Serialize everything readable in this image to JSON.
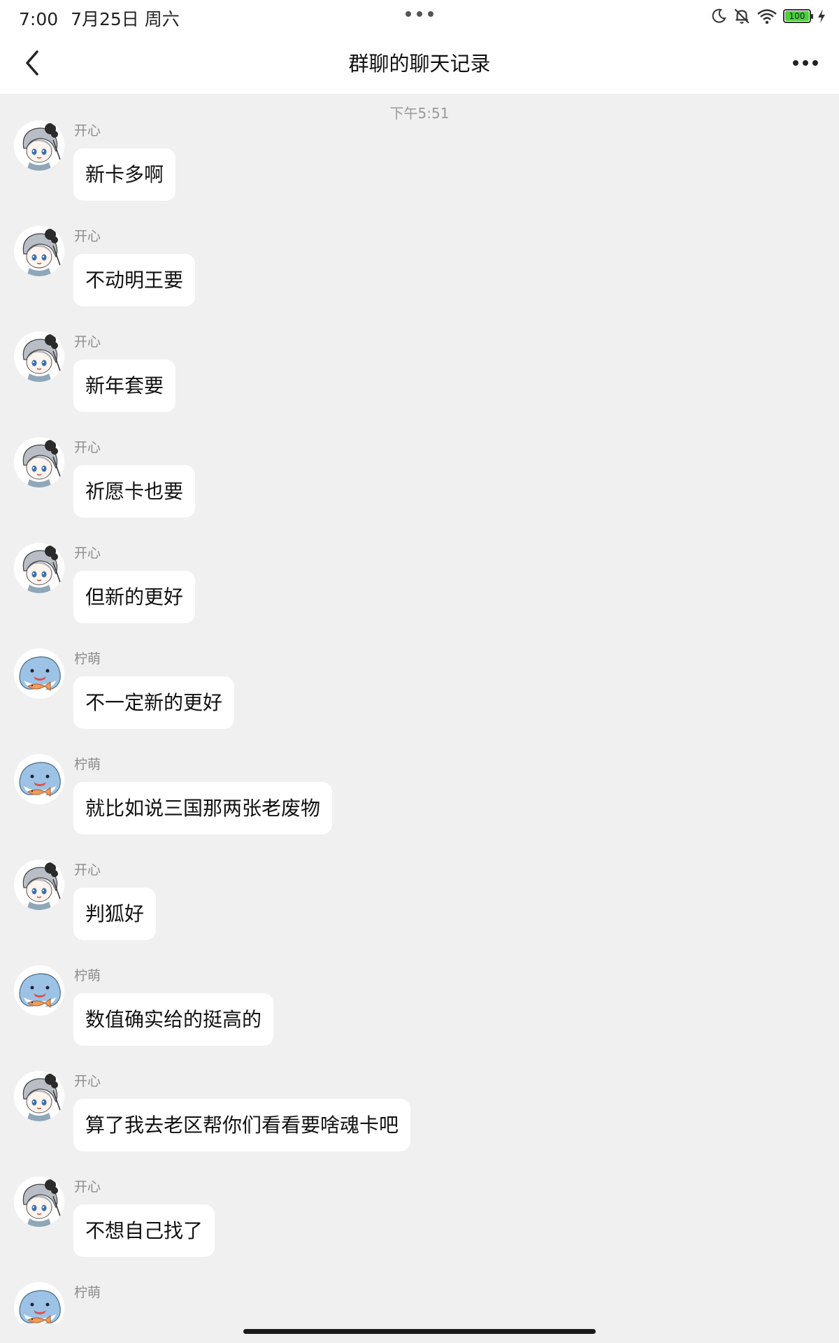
{
  "status_bar": {
    "time": "7:00",
    "date": "7月25日 周六",
    "battery": "100",
    "icons": [
      "moon-icon",
      "bell-off-icon",
      "wifi-icon",
      "battery-icon",
      "charging-icon"
    ]
  },
  "nav": {
    "title": "群聊的聊天记录",
    "back_icon": "chevron-left-icon",
    "more_icon": "more-dots-icon"
  },
  "chat": {
    "timestamp": "下午5:51",
    "messages": [
      {
        "sender": "开心",
        "avatar": "girl-avatar",
        "text": "新卡多啊"
      },
      {
        "sender": "开心",
        "avatar": "girl-avatar",
        "text": "不动明王要"
      },
      {
        "sender": "开心",
        "avatar": "girl-avatar",
        "text": "新年套要"
      },
      {
        "sender": "开心",
        "avatar": "girl-avatar",
        "text": "祈愿卡也要"
      },
      {
        "sender": "开心",
        "avatar": "girl-avatar",
        "text": "但新的更好"
      },
      {
        "sender": "柠萌",
        "avatar": "shark-avatar",
        "text": "不一定新的更好"
      },
      {
        "sender": "柠萌",
        "avatar": "shark-avatar",
        "text": "就比如说三国那两张老废物"
      },
      {
        "sender": "开心",
        "avatar": "girl-avatar",
        "text": "判狐好"
      },
      {
        "sender": "柠萌",
        "avatar": "shark-avatar",
        "text": "数值确实给的挺高的"
      },
      {
        "sender": "开心",
        "avatar": "girl-avatar",
        "text": "算了我去老区帮你们看看要啥魂卡吧"
      },
      {
        "sender": "开心",
        "avatar": "girl-avatar",
        "text": "不想自己找了"
      },
      {
        "sender": "柠萌",
        "avatar": "shark-avatar",
        "text": ""
      }
    ]
  }
}
